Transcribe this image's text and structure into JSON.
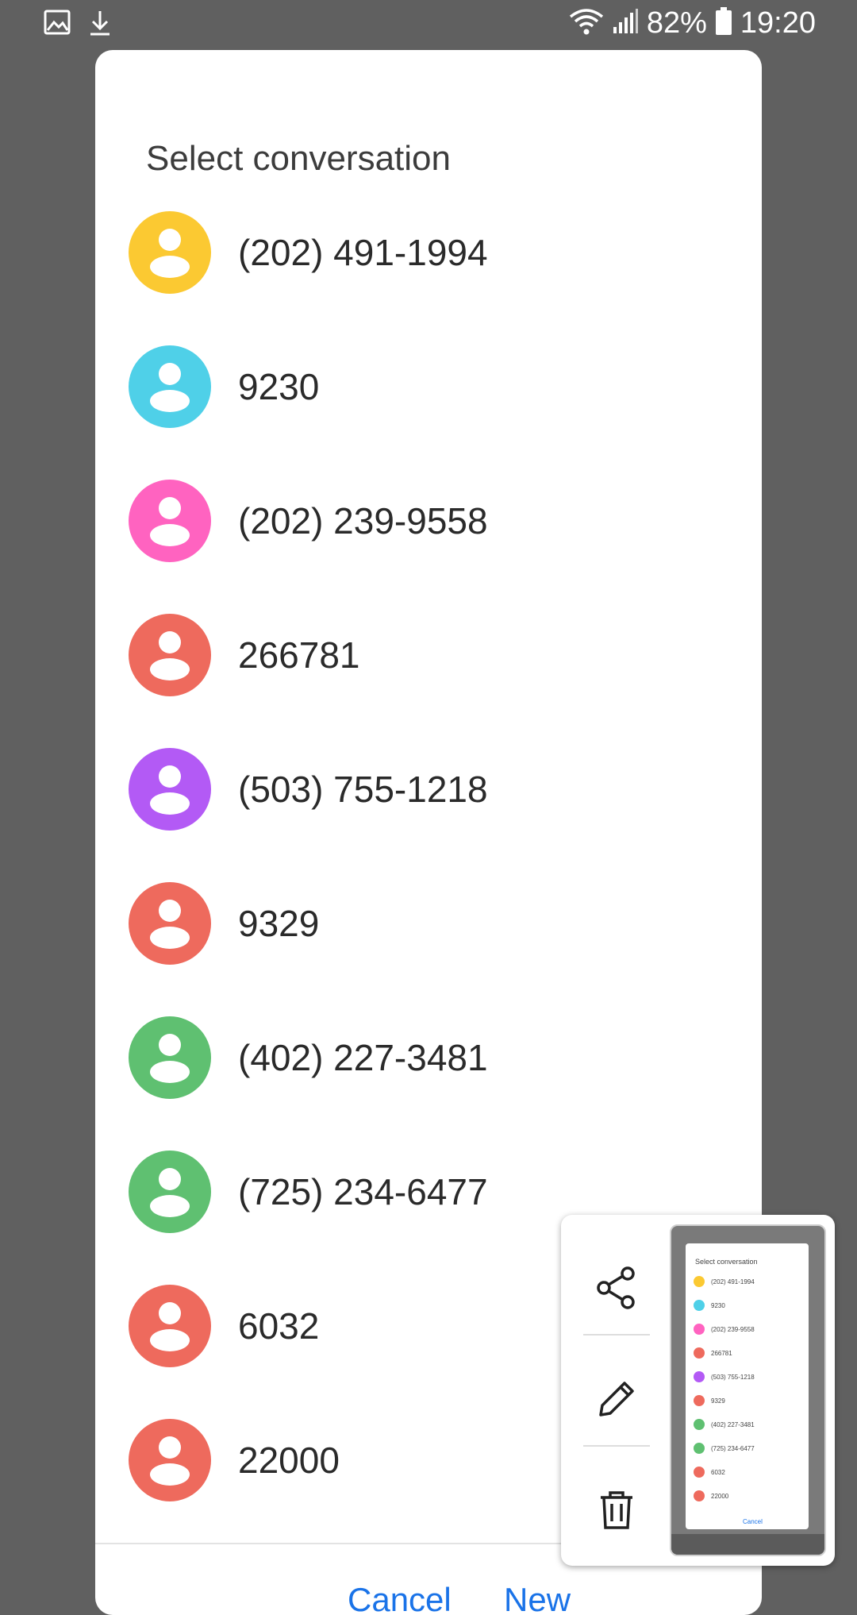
{
  "status_bar": {
    "battery_percent": "82%",
    "time": "19:20",
    "left_icons": [
      "image-icon",
      "download-icon"
    ],
    "right_icons": [
      "wifi-icon",
      "signal-icon",
      "battery-icon"
    ]
  },
  "dialog": {
    "title": "Select conversation",
    "conversations": [
      {
        "label": "(202) 491-1994",
        "color": "#fbc932"
      },
      {
        "label": "9230",
        "color": "#4fd0e8"
      },
      {
        "label": "(202) 239-9558",
        "color": "#ff63c0"
      },
      {
        "label": "266781",
        "color": "#ee6a5d"
      },
      {
        "label": "(503) 755-1218",
        "color": "#b35af5"
      },
      {
        "label": "9329",
        "color": "#ee6a5d"
      },
      {
        "label": "(402) 227-3481",
        "color": "#5fc071"
      },
      {
        "label": "(725) 234-6477",
        "color": "#5fc071"
      },
      {
        "label": "6032",
        "color": "#ee6a5d"
      },
      {
        "label": "22000",
        "color": "#ee6a5d"
      }
    ],
    "actions": {
      "cancel": "Cancel",
      "new": "New"
    }
  },
  "screenshot_panel": {
    "tools": [
      "share-icon",
      "edit-icon",
      "delete-icon"
    ],
    "thumbnail": {
      "title": "Select conversation",
      "rows": [
        "(202) 491-1994",
        "9230",
        "(202) 239-9558",
        "266781",
        "(503) 755-1218",
        "9329",
        "(402) 227-3481",
        "(725) 234-6477",
        "6032",
        "22000"
      ],
      "cancel": "Cancel"
    }
  }
}
